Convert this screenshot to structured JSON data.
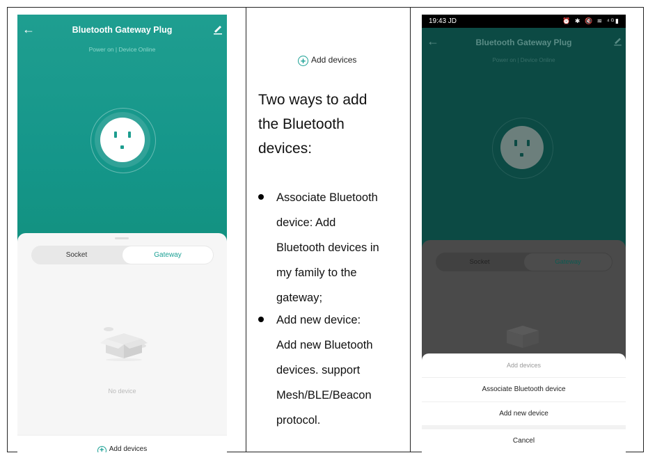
{
  "left_phone": {
    "title": "Bluetooth Gateway Plug",
    "status": "Power on | Device Online",
    "tabs": [
      {
        "label": "Socket",
        "selected": false
      },
      {
        "label": "Gateway",
        "selected": true
      }
    ],
    "empty_text": "No device",
    "add_label": "Add devices"
  },
  "instructions": {
    "add_label": "Add devices",
    "heading_lines": [
      "Two ways to add",
      "the Bluetooth",
      "devices:"
    ],
    "bullets": [
      {
        "lines": [
          "Associate Bluetooth",
          "device: Add",
          "Bluetooth devices in",
          "my family to the",
          "gateway;"
        ]
      },
      {
        "lines": [
          "Add new device:",
          "Add new Bluetooth",
          "devices. support",
          "Mesh/BLE/Beacon",
          "protocol."
        ]
      }
    ]
  },
  "right_phone": {
    "status_time": "19:43 JD",
    "status_icons": "⏰ ✱ 🔇 ≋ ⁴ᴳ▮",
    "title": "Bluetooth Gateway Plug",
    "status": "Power on | Device Online",
    "tabs": [
      {
        "label": "Socket",
        "selected": false
      },
      {
        "label": "Gateway",
        "selected": true
      }
    ],
    "action_sheet": {
      "header": "Add devices",
      "option_associate": "Associate Bluetooth device",
      "option_new": "Add new device",
      "cancel": "Cancel"
    }
  },
  "colors": {
    "teal": "#1aa094",
    "dim_teal": "#0c4a44"
  }
}
